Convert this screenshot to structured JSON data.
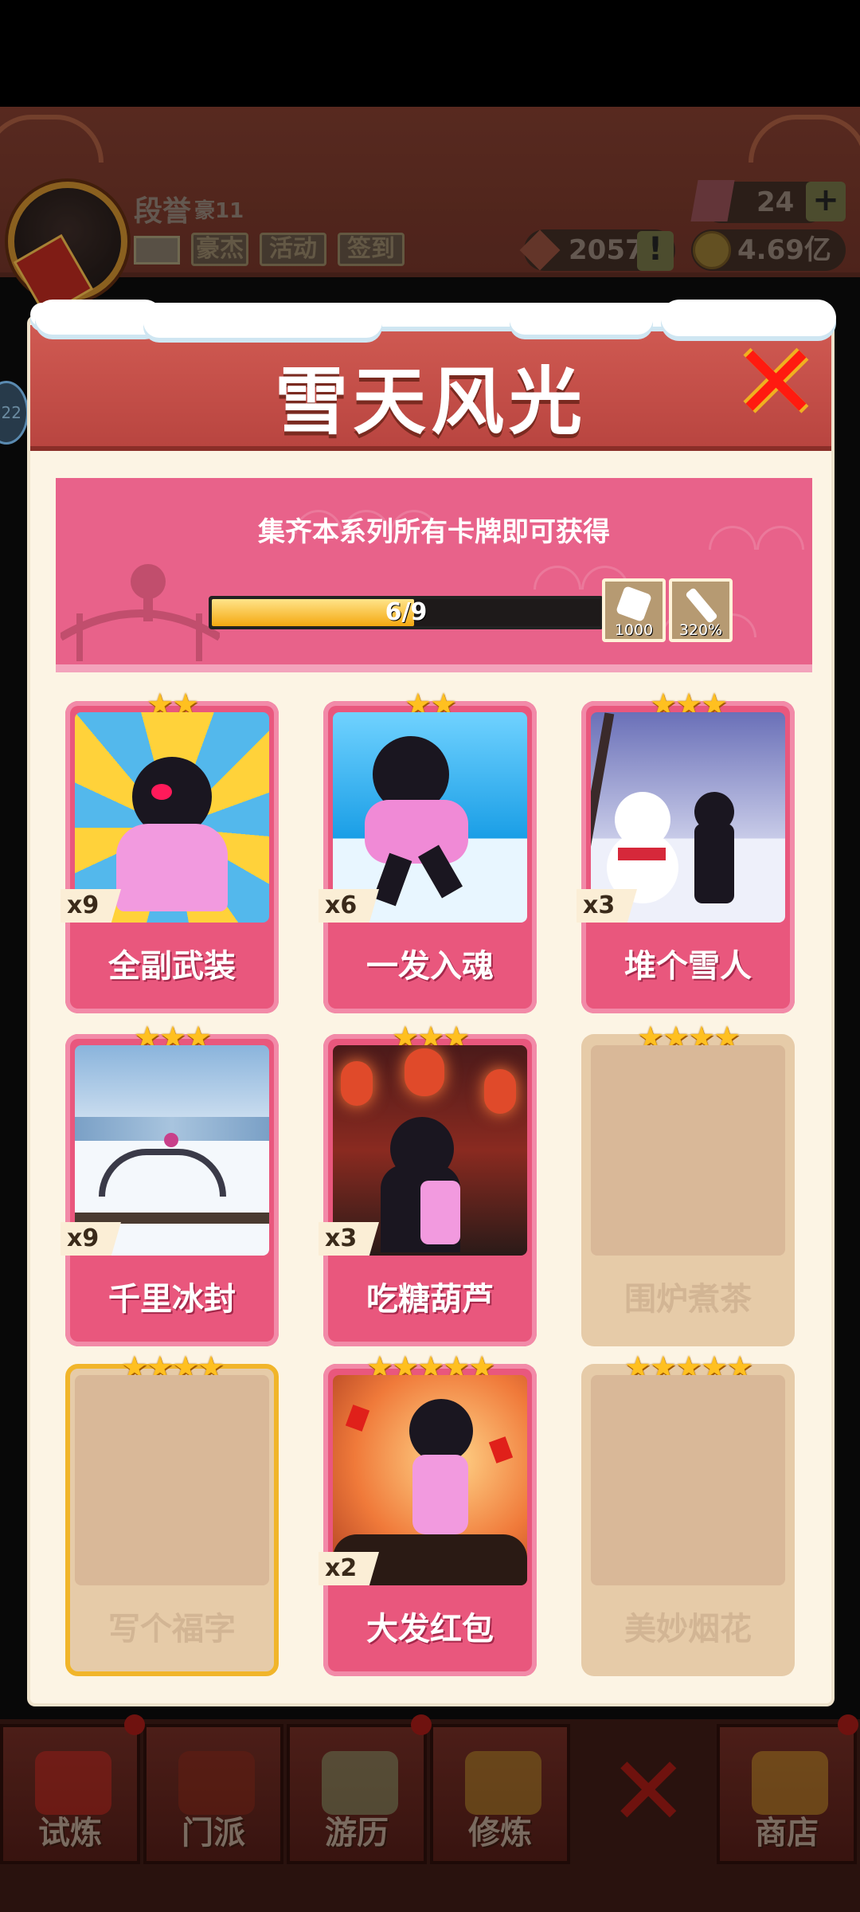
{
  "hud": {
    "player_name": "段誉",
    "player_rank": "豪11",
    "chips": [
      "豪杰",
      "活动",
      "签到"
    ],
    "gems": "24",
    "gems_plus": "+",
    "power": "2057",
    "power_alert": "!",
    "gold": "4.69亿",
    "side_bubble": "22"
  },
  "modal": {
    "title": "雪天风光",
    "banner_text": "集齐本系列所有卡牌即可获得",
    "progress": {
      "current": 6,
      "total": 9,
      "label": "6/9"
    },
    "rewards": [
      {
        "icon": "dice-icon",
        "value": "1000"
      },
      {
        "icon": "sword-icon",
        "value": "320%"
      }
    ]
  },
  "cards": [
    {
      "name": "全副武装",
      "stars": "★★",
      "count": "x9",
      "owned": true
    },
    {
      "name": "一发入魂",
      "stars": "★★",
      "count": "x6",
      "owned": true
    },
    {
      "name": "堆个雪人",
      "stars": "★★★",
      "count": "x3",
      "owned": true
    },
    {
      "name": "千里冰封",
      "stars": "★★★",
      "count": "x9",
      "owned": true
    },
    {
      "name": "吃糖葫芦",
      "stars": "★★★",
      "count": "x3",
      "owned": true
    },
    {
      "name": "围炉煮茶",
      "stars": "★★★★",
      "count": "",
      "owned": false
    },
    {
      "name": "写个福字",
      "stars": "★★★★",
      "count": "",
      "owned": false
    },
    {
      "name": "大发红包",
      "stars": "★★★★★",
      "count": "x2",
      "owned": true
    },
    {
      "name": "美妙烟花",
      "stars": "★★★★★",
      "count": "",
      "owned": false
    }
  ],
  "nav": {
    "tabs": [
      "试炼",
      "门派",
      "游历",
      "修炼",
      "商店"
    ],
    "close": "✕"
  },
  "colors": {
    "accent": "#e9577d",
    "header": "#c24b45",
    "gold": "#f4a810"
  }
}
